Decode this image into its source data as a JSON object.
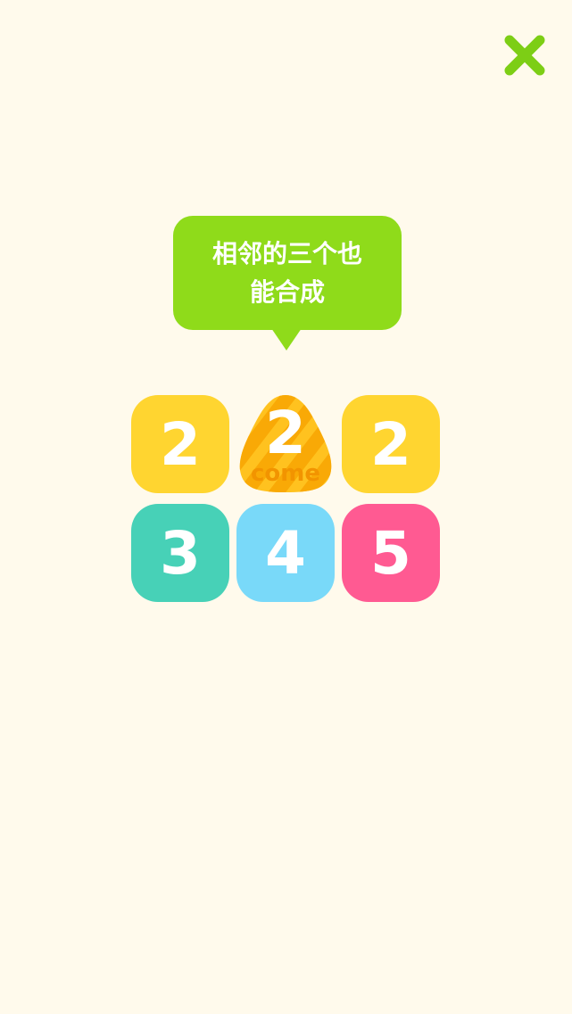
{
  "close_button": {
    "icon": "close-icon",
    "color": "#7DCE15"
  },
  "hint_bubble": {
    "line1": "相邻的三个也",
    "line2": "能合成",
    "color": "#8FDB1A"
  },
  "board": {
    "tiles": [
      {
        "number": "2",
        "color": "#FFD530"
      },
      {
        "number": "2",
        "label": "come",
        "color": "#FFC21F"
      },
      {
        "number": "2",
        "color": "#FFD530"
      },
      {
        "number": "3",
        "color": "#47D1B7"
      },
      {
        "number": "4",
        "color": "#79D9F9"
      },
      {
        "number": "5",
        "color": "#FF5A92"
      }
    ]
  }
}
